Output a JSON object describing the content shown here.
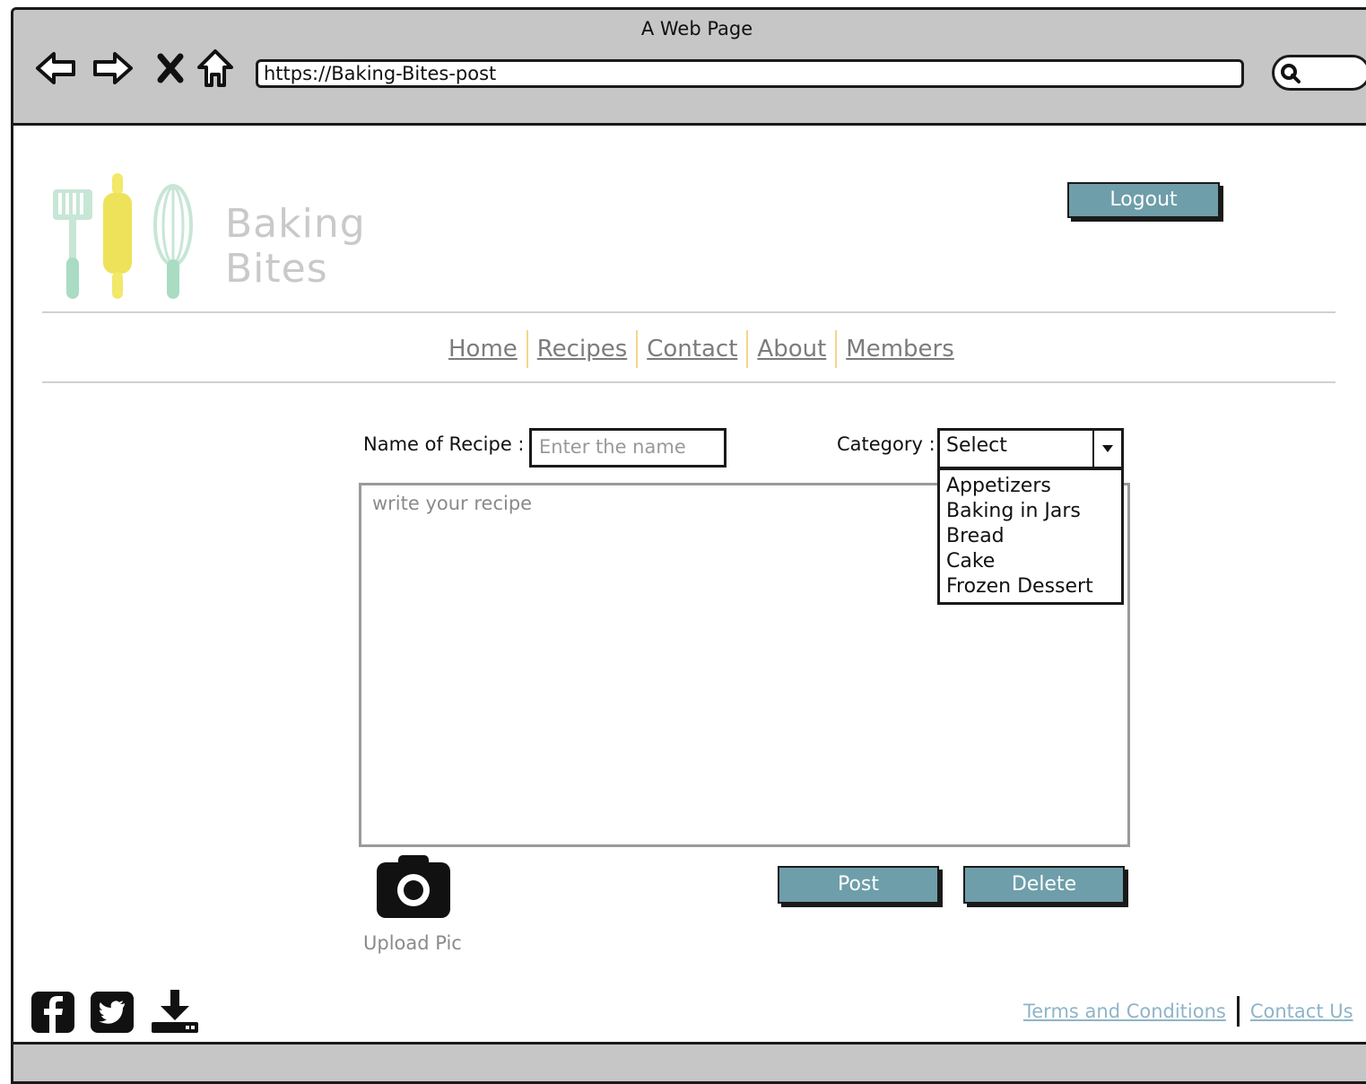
{
  "window": {
    "title": "A Web Page",
    "url": "https://Baking-Bites-post"
  },
  "logo": {
    "line1": "Baking",
    "line2": "Bites"
  },
  "header": {
    "logout_label": "Logout"
  },
  "nav": {
    "items": [
      {
        "label": "Home"
      },
      {
        "label": "Recipes"
      },
      {
        "label": "Contact"
      },
      {
        "label": "About"
      },
      {
        "label": "Members"
      }
    ]
  },
  "form": {
    "name_label": "Name of Recipe :",
    "name_placeholder": "Enter the name",
    "category_label": "Category :",
    "category_selected": "Select",
    "category_options": [
      "Appetizers",
      "Baking in Jars",
      "Bread",
      "Cake",
      "Frozen Dessert"
    ],
    "recipe_placeholder": "write your recipe",
    "upload_label": "Upload Pic",
    "post_label": "Post",
    "delete_label": "Delete"
  },
  "footer": {
    "terms_label": "Terms and Conditions",
    "contact_label": "Contact Us",
    "social_icons": [
      "facebook-icon",
      "twitter-icon",
      "download-icon"
    ]
  }
}
